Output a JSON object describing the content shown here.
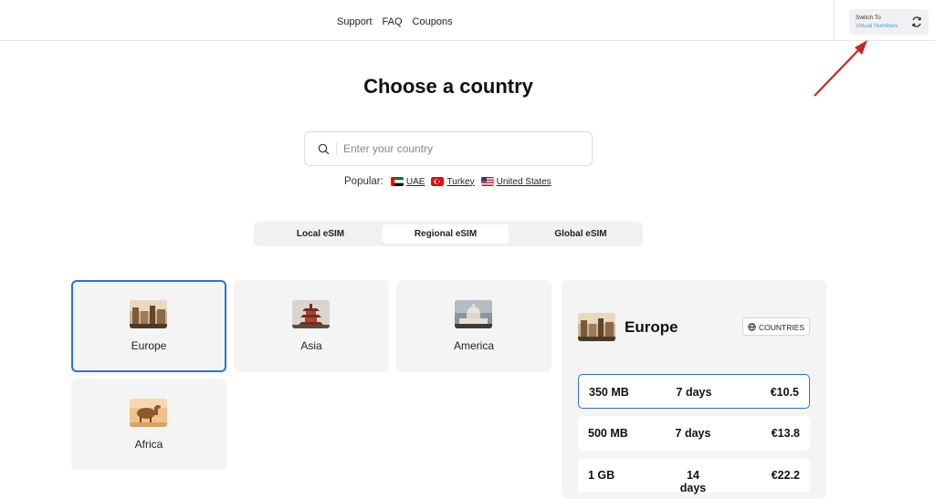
{
  "header": {
    "nav": [
      "Support",
      "FAQ",
      "Coupons"
    ],
    "switch_line1": "Switch To",
    "switch_line2": "Virtual Numbers"
  },
  "title": "Choose a country",
  "search": {
    "placeholder": "Enter your country",
    "value": ""
  },
  "popular": {
    "label": "Popular:",
    "items": [
      {
        "name": "UAE",
        "flag": "uae-flag-icon"
      },
      {
        "name": "Turkey",
        "flag": "turkey-flag-icon"
      },
      {
        "name": "United States",
        "flag": "us-flag-icon"
      }
    ]
  },
  "tabs": [
    {
      "label": "Local eSIM",
      "active": false
    },
    {
      "label": "Regional eSIM",
      "active": true
    },
    {
      "label": "Global eSIM",
      "active": false
    }
  ],
  "regions": [
    {
      "name": "Europe",
      "selected": true,
      "icon": "europe-image"
    },
    {
      "name": "Asia",
      "selected": false,
      "icon": "asia-pagoda-image"
    },
    {
      "name": "America",
      "selected": false,
      "icon": "america-capitol-image"
    },
    {
      "name": "Africa",
      "selected": false,
      "icon": "africa-camel-image"
    }
  ],
  "panel": {
    "title": "Europe",
    "countries_label": "COUNTRIES",
    "plans": [
      {
        "data": "350 MB",
        "duration": "7 days",
        "price": "€10.5",
        "selected": true
      },
      {
        "data": "500 MB",
        "duration": "7 days",
        "price": "€13.8",
        "selected": false
      },
      {
        "data": "1 GB",
        "duration": "14 days",
        "price": "€22.2",
        "selected": false
      }
    ]
  },
  "colors": {
    "accent": "#2f6fd6",
    "link_blue": "#4a9fd8",
    "arrow_red": "#c62828",
    "card_bg": "#f4f4f4"
  }
}
